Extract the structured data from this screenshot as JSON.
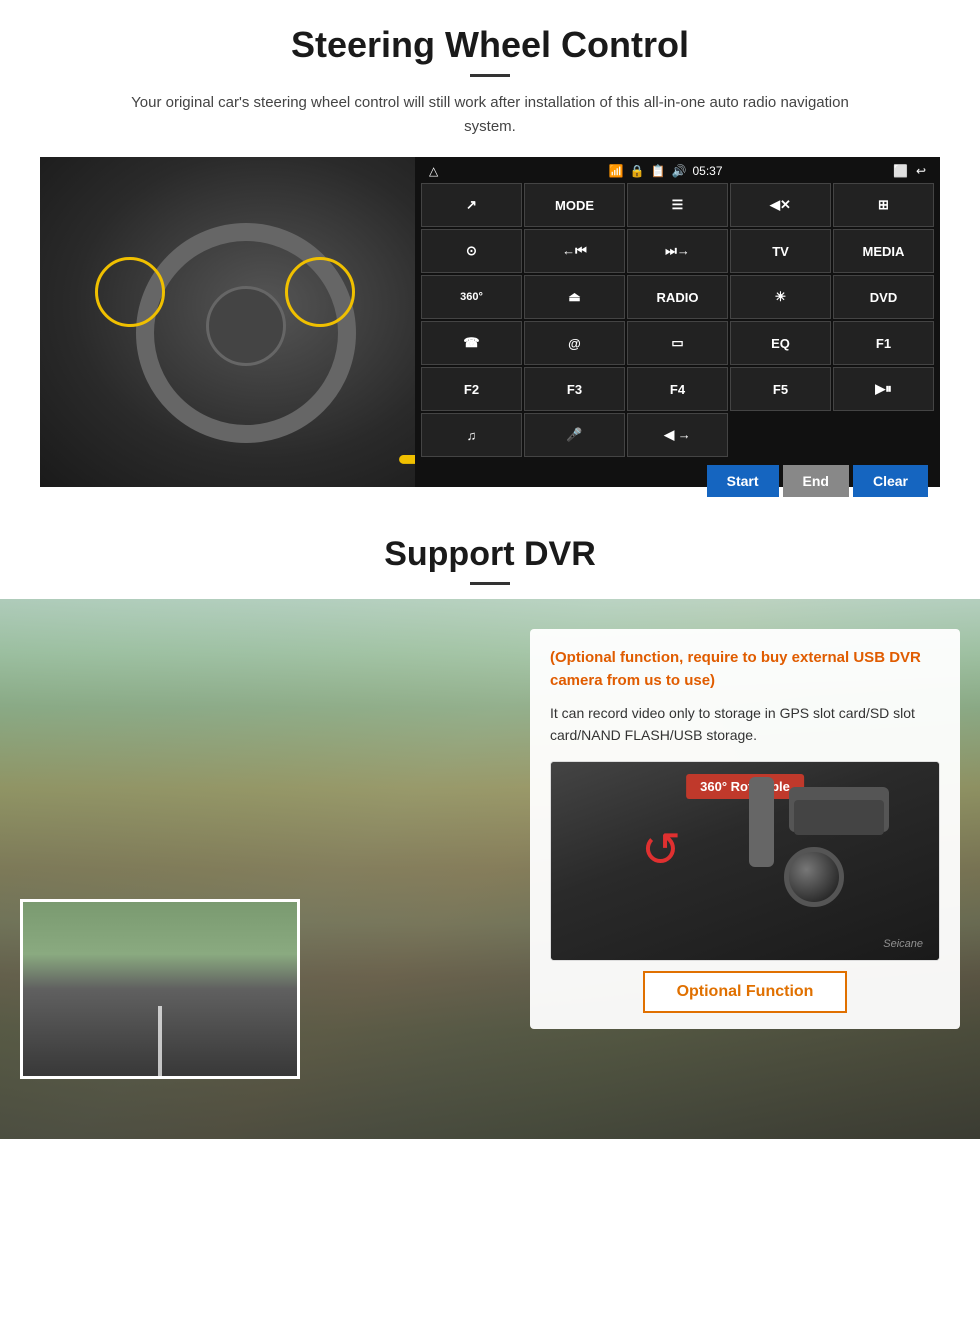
{
  "steering": {
    "title": "Steering Wheel Control",
    "subtitle": "Your original car's steering wheel control will still work after installation of this all-in-one auto radio navigation system.",
    "topbar": {
      "time": "05:37",
      "icons": [
        "wifi",
        "lock",
        "sim",
        "volume-mute"
      ]
    },
    "radio_buttons": [
      {
        "label": "⬅",
        "id": "nav-left"
      },
      {
        "label": "MODE",
        "id": "mode"
      },
      {
        "label": "☰",
        "id": "menu"
      },
      {
        "label": "🔇",
        "id": "mute"
      },
      {
        "label": "⊞",
        "id": "apps"
      },
      {
        "label": "⊙",
        "id": "settings"
      },
      {
        "label": "⏮",
        "id": "prev"
      },
      {
        "label": "⏭",
        "id": "next"
      },
      {
        "label": "TV",
        "id": "tv"
      },
      {
        "label": "MEDIA",
        "id": "media"
      },
      {
        "label": "360",
        "id": "cam360"
      },
      {
        "label": "⏏",
        "id": "eject"
      },
      {
        "label": "RADIO",
        "id": "radio"
      },
      {
        "label": "☀",
        "id": "brightness"
      },
      {
        "label": "DVD",
        "id": "dvd"
      },
      {
        "label": "☎",
        "id": "phone"
      },
      {
        "label": "@",
        "id": "web"
      },
      {
        "label": "⬛",
        "id": "screen"
      },
      {
        "label": "EQ",
        "id": "eq"
      },
      {
        "label": "F1",
        "id": "f1"
      },
      {
        "label": "F2",
        "id": "f2"
      },
      {
        "label": "F3",
        "id": "f3"
      },
      {
        "label": "F4",
        "id": "f4"
      },
      {
        "label": "F5",
        "id": "f5"
      },
      {
        "label": "▶⏸",
        "id": "play-pause"
      },
      {
        "label": "♫",
        "id": "music"
      },
      {
        "label": "🎤",
        "id": "mic"
      },
      {
        "label": "⏮⏭",
        "id": "prev-next"
      }
    ],
    "bottom_buttons": {
      "start": "Start",
      "end": "End",
      "clear": "Clear"
    }
  },
  "dvr": {
    "title": "Support DVR",
    "optional_text": "(Optional function, require to buy external USB DVR camera from us to use)",
    "desc_text": "It can record video only to storage in GPS slot card/SD slot card/NAND FLASH/USB storage.",
    "camera_badge": "360° Rotatable",
    "watermark": "Seicane",
    "optional_button": "Optional Function"
  }
}
